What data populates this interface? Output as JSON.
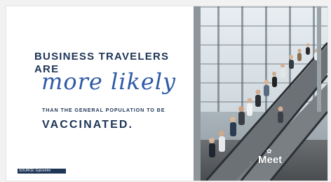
{
  "slide": {
    "line1_main": "BUSINESS TRAVELERS",
    "line1_small": "ARE",
    "script_text": "more likely",
    "line3": "THAN THE GENERAL POPULATION TO BE",
    "line4": "VACCINATED.",
    "source_label": "SOURCE: Epicentre"
  },
  "logo": {
    "text": "Meet"
  },
  "colors": {
    "navy": "#1d3557",
    "script_blue": "#2f5aa7"
  }
}
